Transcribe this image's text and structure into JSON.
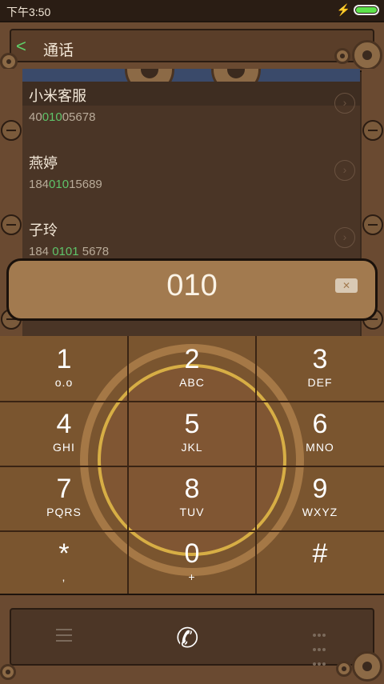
{
  "status": {
    "time": "下午3:50"
  },
  "header": {
    "title": "通话",
    "back": "<"
  },
  "contacts": [
    {
      "name": "小米客服",
      "num_pre": "40",
      "num_hl": "010",
      "num_post": "05678"
    },
    {
      "name": "燕婷",
      "num_pre": "184",
      "num_hl": "010",
      "num_post": "15689"
    },
    {
      "name": "子玲",
      "num_pre": "184 ",
      "num_hl": "0101",
      "num_post": " 5678"
    }
  ],
  "dialed": "010",
  "keys": [
    {
      "digit": "1",
      "letters": "ᴏ.ᴏ"
    },
    {
      "digit": "2",
      "letters": "ABC"
    },
    {
      "digit": "3",
      "letters": "DEF"
    },
    {
      "digit": "4",
      "letters": "GHI"
    },
    {
      "digit": "5",
      "letters": "JKL"
    },
    {
      "digit": "6",
      "letters": "MNO"
    },
    {
      "digit": "7",
      "letters": "PQRS"
    },
    {
      "digit": "8",
      "letters": "TUV"
    },
    {
      "digit": "9",
      "letters": "WXYZ"
    },
    {
      "digit": "*",
      "letters": ","
    },
    {
      "digit": "0",
      "letters": "+"
    },
    {
      "digit": "#",
      "letters": ""
    }
  ],
  "colors": {
    "accent_green": "#5fc46a",
    "wood": "#7a552f",
    "panel": "#4a3526"
  }
}
